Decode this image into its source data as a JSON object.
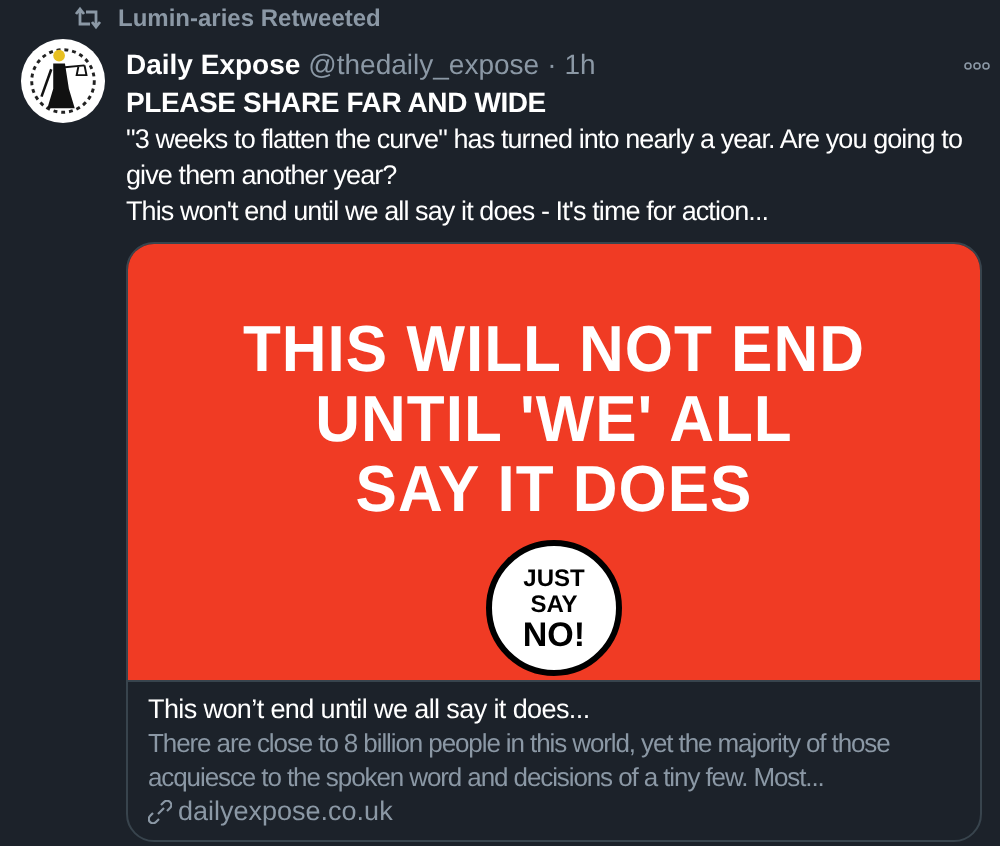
{
  "retweet": {
    "label": "Lumin-aries Retweeted"
  },
  "tweet": {
    "name": "Daily Expose",
    "handle": "@thedaily_expose",
    "separator": "·",
    "time": "1h",
    "headline": "PLEASE SHARE FAR AND WIDE",
    "lines": [
      "\"3 weeks to flatten the curve\" has turned into nearly a year. Are you going to give them another year?",
      "This won't end until we all say it does - It's time for action..."
    ]
  },
  "card": {
    "image_lines": [
      "THIS WILL NOT END",
      "UNTIL 'WE' ALL",
      "SAY IT DOES"
    ],
    "badge_lines": [
      "JUST",
      "SAY",
      "NO!"
    ],
    "title": "This won’t end until we all say it does...",
    "description": "There are close to 8 billion people in this world, yet the majority of those acquiesce to the spoken word and decisions of a tiny few. Most...",
    "domain": "dailyexpose.co.uk"
  }
}
